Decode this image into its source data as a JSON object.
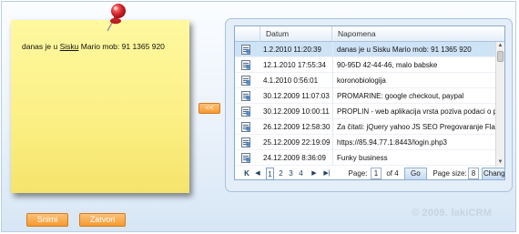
{
  "note": {
    "text_prefix": "danas je u ",
    "text_underlined": "Sisku",
    "text_suffix": " Mario mob: 91 1365 920"
  },
  "buttons": {
    "save": "Snimi",
    "close": "Zatvori",
    "back": "<<"
  },
  "grid": {
    "columns": {
      "date": "Datum",
      "note": "Napomena"
    },
    "rows": [
      {
        "date": "1.2.2010 11:20:39",
        "note": "danas je u Sisku Mario mob: 91 1365 920",
        "selected": true
      },
      {
        "date": "12.1.2010 17:55:34",
        "note": "90-95D 42-44-46, malo babske"
      },
      {
        "date": "4.1.2010 0:56:01",
        "note": "koronobiologija"
      },
      {
        "date": "30.12.2009 11:07:03",
        "note": "PROMARINE: google checkout, paypal"
      },
      {
        "date": "30.12.2009 10:00:11",
        "note": "PROPLIN - web aplikacija vrsta poziva podaci o p"
      },
      {
        "date": "26.12.2009 12:58:30",
        "note": "Za čitati: jQuery yahoo JS SEO Pregovaranje Flash"
      },
      {
        "date": "25.12.2009 22:19:09",
        "note": "https://85.94.77.1:8443/login.php3"
      },
      {
        "date": "24.12.2009 8:36:09",
        "note": "Funky business"
      }
    ]
  },
  "pager": {
    "first": "K",
    "prev": "◀",
    "pages": [
      "1",
      "2",
      "3",
      "4"
    ],
    "next": "▶",
    "last": "▶|",
    "page_label": "Page:",
    "page_value": "1",
    "of_label": "of 4",
    "go_label": "Go",
    "size_label": "Page size:",
    "size_value": "8",
    "change_label": "Change"
  },
  "watermark": "© 2009. lakiCRM",
  "colors": {
    "note_yellow": "#fbef83",
    "button_orange": "#f69a2e",
    "pin_red": "#d8262c",
    "selected_row": "#cfe3f7"
  }
}
